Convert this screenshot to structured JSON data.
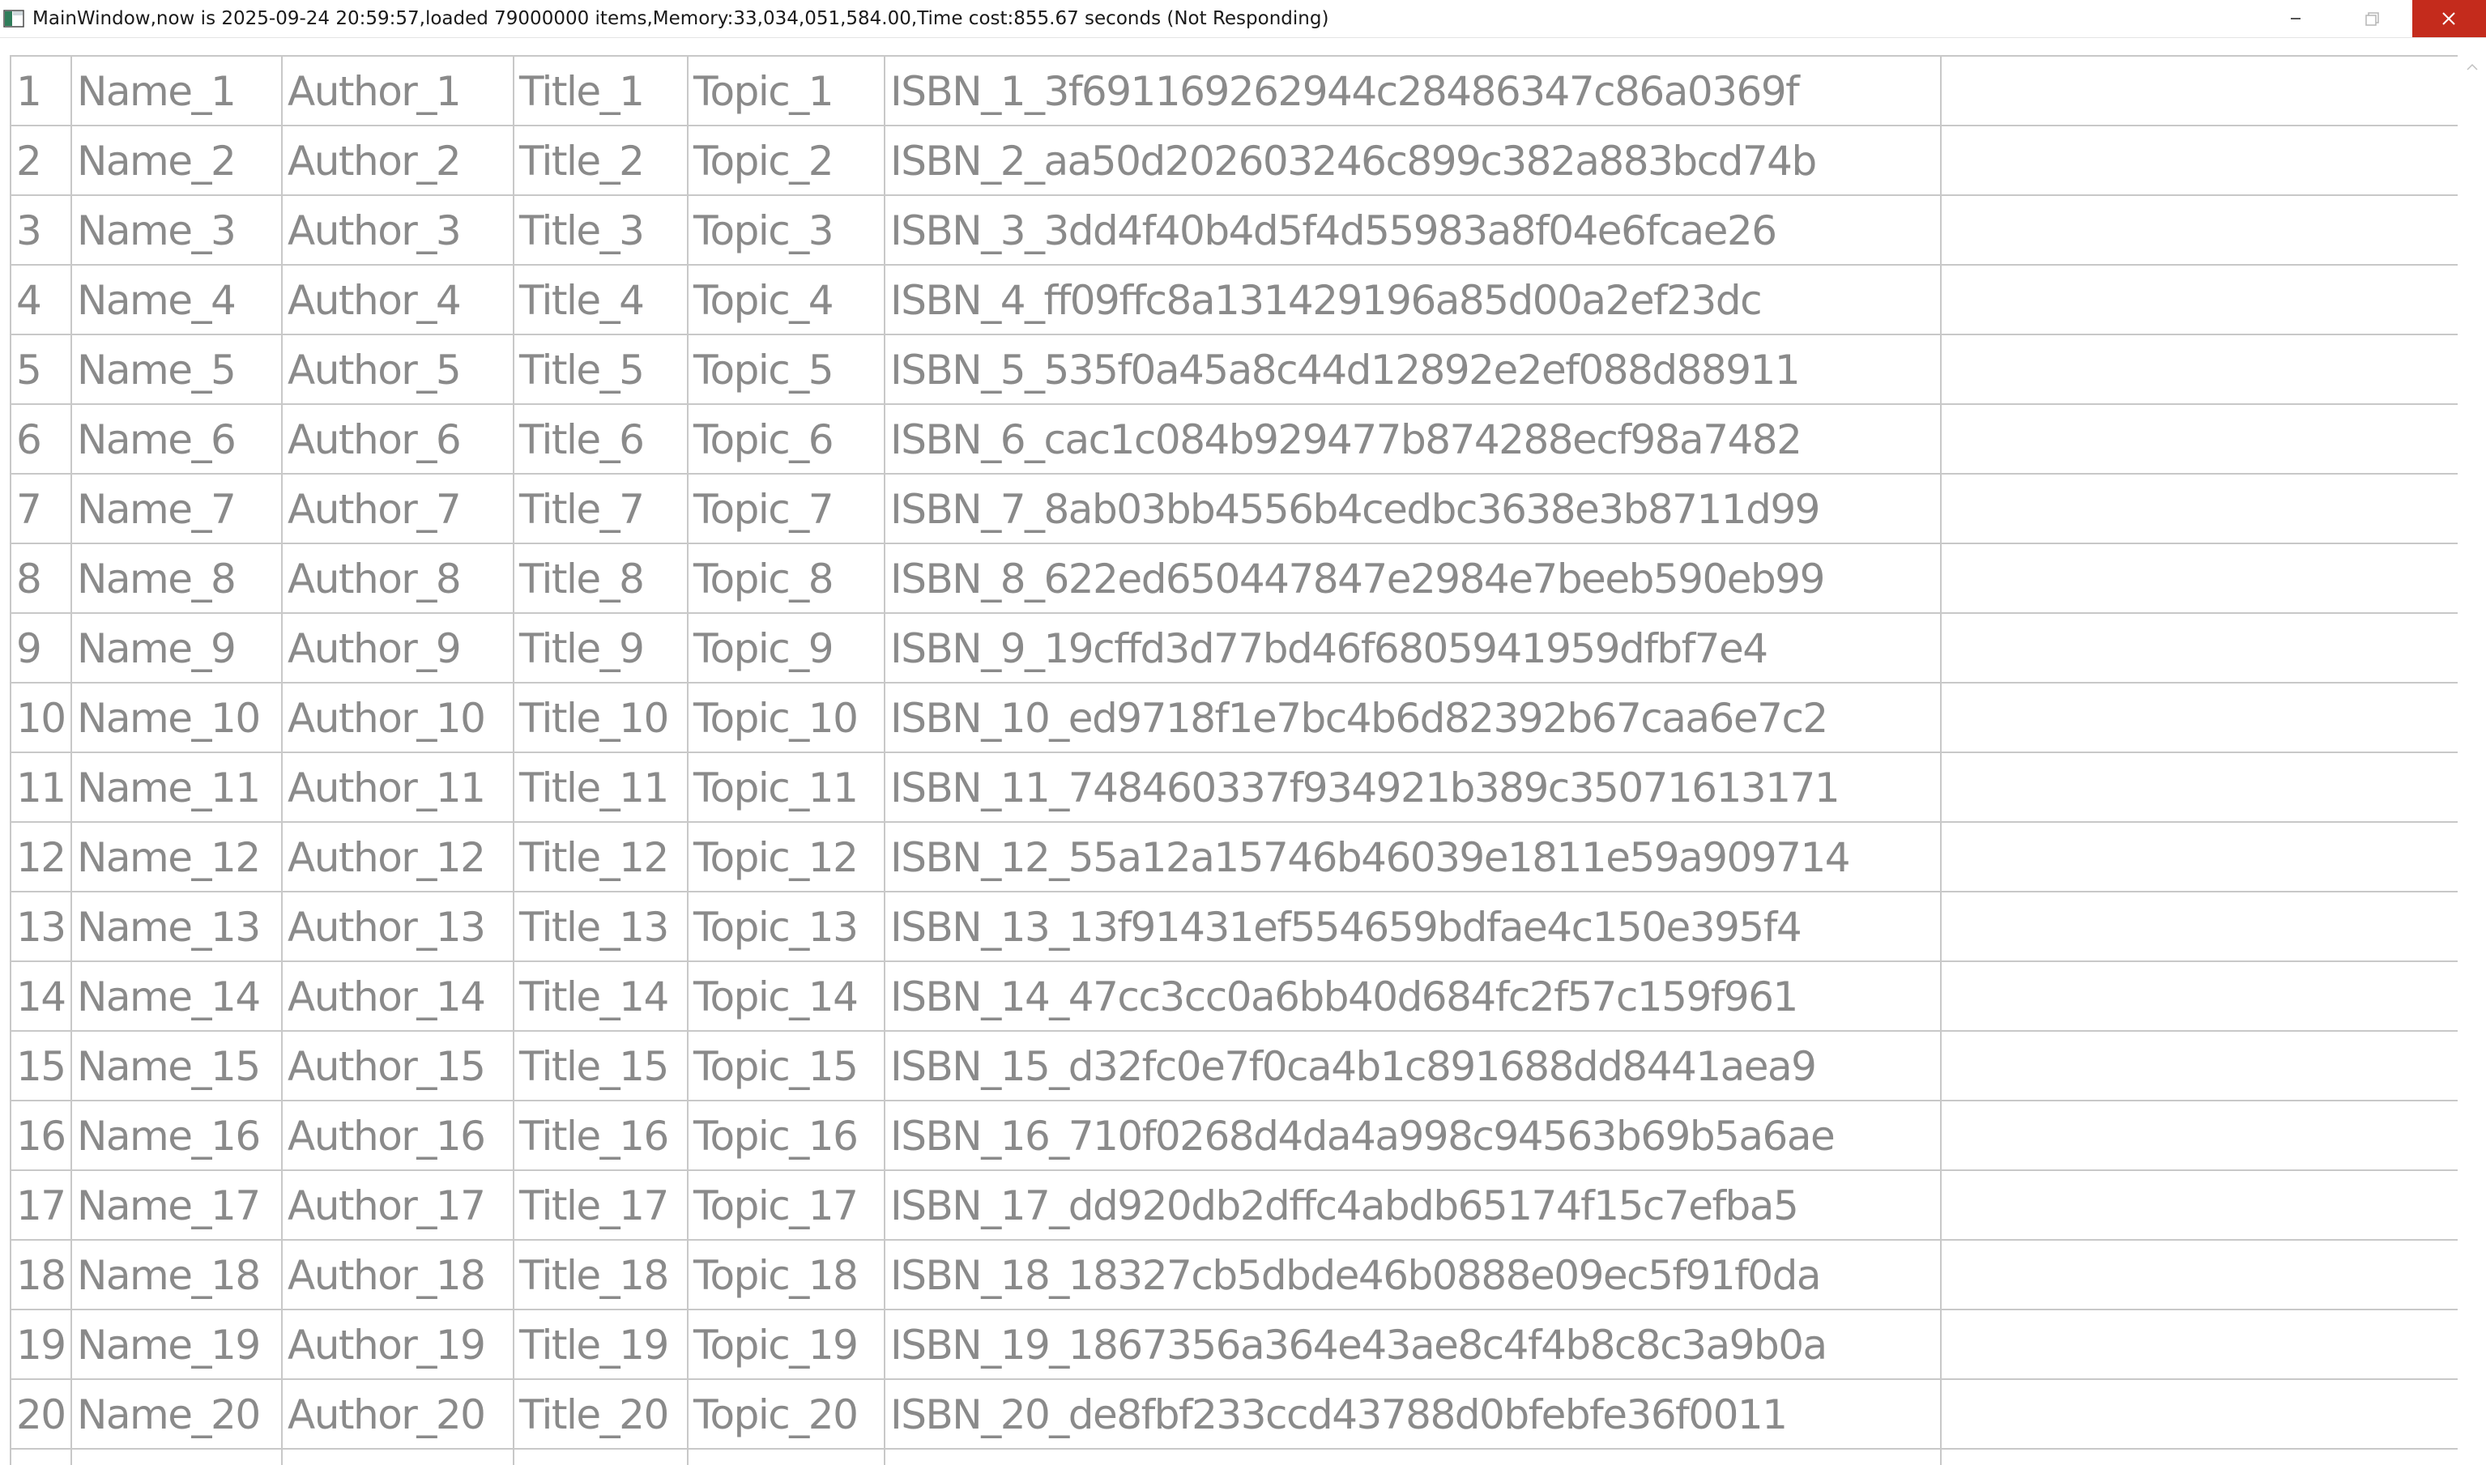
{
  "window": {
    "title": "MainWindow,now is 2025-09-24 20:59:57,loaded 79000000 items,Memory:33,034,051,584.00,Time cost:855.67 seconds (Not Responding)",
    "app_icon": "window-app-icon",
    "controls": {
      "minimize_icon": "minimize-icon",
      "maximize_icon": "maximize-icon",
      "close_icon": "close-icon",
      "close_color": "#c42b1c"
    }
  },
  "grid": {
    "text_color": "#8a8a8a",
    "line_color": "#c8c8c8",
    "rows": [
      {
        "idx": "1",
        "name": "Name_1",
        "author": "Author_1",
        "title": "Title_1",
        "topic": "Topic_1",
        "isbn": "ISBN_1_3f691169262944c28486347c86a0369f"
      },
      {
        "idx": "2",
        "name": "Name_2",
        "author": "Author_2",
        "title": "Title_2",
        "topic": "Topic_2",
        "isbn": "ISBN_2_aa50d202603246c899c382a883bcd74b"
      },
      {
        "idx": "3",
        "name": "Name_3",
        "author": "Author_3",
        "title": "Title_3",
        "topic": "Topic_3",
        "isbn": "ISBN_3_3dd4f40b4d5f4d55983a8f04e6fcae26"
      },
      {
        "idx": "4",
        "name": "Name_4",
        "author": "Author_4",
        "title": "Title_4",
        "topic": "Topic_4",
        "isbn": "ISBN_4_ff09ffc8a131429196a85d00a2ef23dc"
      },
      {
        "idx": "5",
        "name": "Name_5",
        "author": "Author_5",
        "title": "Title_5",
        "topic": "Topic_5",
        "isbn": "ISBN_5_535f0a45a8c44d12892e2ef088d88911"
      },
      {
        "idx": "6",
        "name": "Name_6",
        "author": "Author_6",
        "title": "Title_6",
        "topic": "Topic_6",
        "isbn": "ISBN_6_cac1c084b929477b874288ecf98a7482"
      },
      {
        "idx": "7",
        "name": "Name_7",
        "author": "Author_7",
        "title": "Title_7",
        "topic": "Topic_7",
        "isbn": "ISBN_7_8ab03bb4556b4cedbc3638e3b8711d99"
      },
      {
        "idx": "8",
        "name": "Name_8",
        "author": "Author_8",
        "title": "Title_8",
        "topic": "Topic_8",
        "isbn": "ISBN_8_622ed650447847e2984e7beeb590eb99"
      },
      {
        "idx": "9",
        "name": "Name_9",
        "author": "Author_9",
        "title": "Title_9",
        "topic": "Topic_9",
        "isbn": "ISBN_9_19cffd3d77bd46f6805941959dfbf7e4"
      },
      {
        "idx": "10",
        "name": "Name_10",
        "author": "Author_10",
        "title": "Title_10",
        "topic": "Topic_10",
        "isbn": "ISBN_10_ed9718f1e7bc4b6d82392b67caa6e7c2"
      },
      {
        "idx": "11",
        "name": "Name_11",
        "author": "Author_11",
        "title": "Title_11",
        "topic": "Topic_11",
        "isbn": "ISBN_11_748460337f934921b389c35071613171"
      },
      {
        "idx": "12",
        "name": "Name_12",
        "author": "Author_12",
        "title": "Title_12",
        "topic": "Topic_12",
        "isbn": "ISBN_12_55a12a15746b46039e1811e59a909714"
      },
      {
        "idx": "13",
        "name": "Name_13",
        "author": "Author_13",
        "title": "Title_13",
        "topic": "Topic_13",
        "isbn": "ISBN_13_13f91431ef554659bdfae4c150e395f4"
      },
      {
        "idx": "14",
        "name": "Name_14",
        "author": "Author_14",
        "title": "Title_14",
        "topic": "Topic_14",
        "isbn": "ISBN_14_47cc3cc0a6bb40d684fc2f57c159f961"
      },
      {
        "idx": "15",
        "name": "Name_15",
        "author": "Author_15",
        "title": "Title_15",
        "topic": "Topic_15",
        "isbn": "ISBN_15_d32fc0e7f0ca4b1c891688dd8441aea9"
      },
      {
        "idx": "16",
        "name": "Name_16",
        "author": "Author_16",
        "title": "Title_16",
        "topic": "Topic_16",
        "isbn": "ISBN_16_710f0268d4da4a998c94563b69b5a6ae"
      },
      {
        "idx": "17",
        "name": "Name_17",
        "author": "Author_17",
        "title": "Title_17",
        "topic": "Topic_17",
        "isbn": "ISBN_17_dd920db2dffc4abdb65174f15c7efba5"
      },
      {
        "idx": "18",
        "name": "Name_18",
        "author": "Author_18",
        "title": "Title_18",
        "topic": "Topic_18",
        "isbn": "ISBN_18_18327cb5dbde46b0888e09ec5f91f0da"
      },
      {
        "idx": "19",
        "name": "Name_19",
        "author": "Author_19",
        "title": "Title_19",
        "topic": "Topic_19",
        "isbn": "ISBN_19_1867356a364e43ae8c4f4b8c8c3a9b0a"
      },
      {
        "idx": "20",
        "name": "Name_20",
        "author": "Author_20",
        "title": "Title_20",
        "topic": "Topic_20",
        "isbn": "ISBN_20_de8fbf233ccd43788d0bfebfe36f0011"
      },
      {
        "idx": "",
        "name": "",
        "author": "",
        "title": "",
        "topic": "",
        "isbn": ""
      }
    ]
  },
  "scrollbar": {
    "up_icon": "scroll-up-arrow-icon"
  }
}
